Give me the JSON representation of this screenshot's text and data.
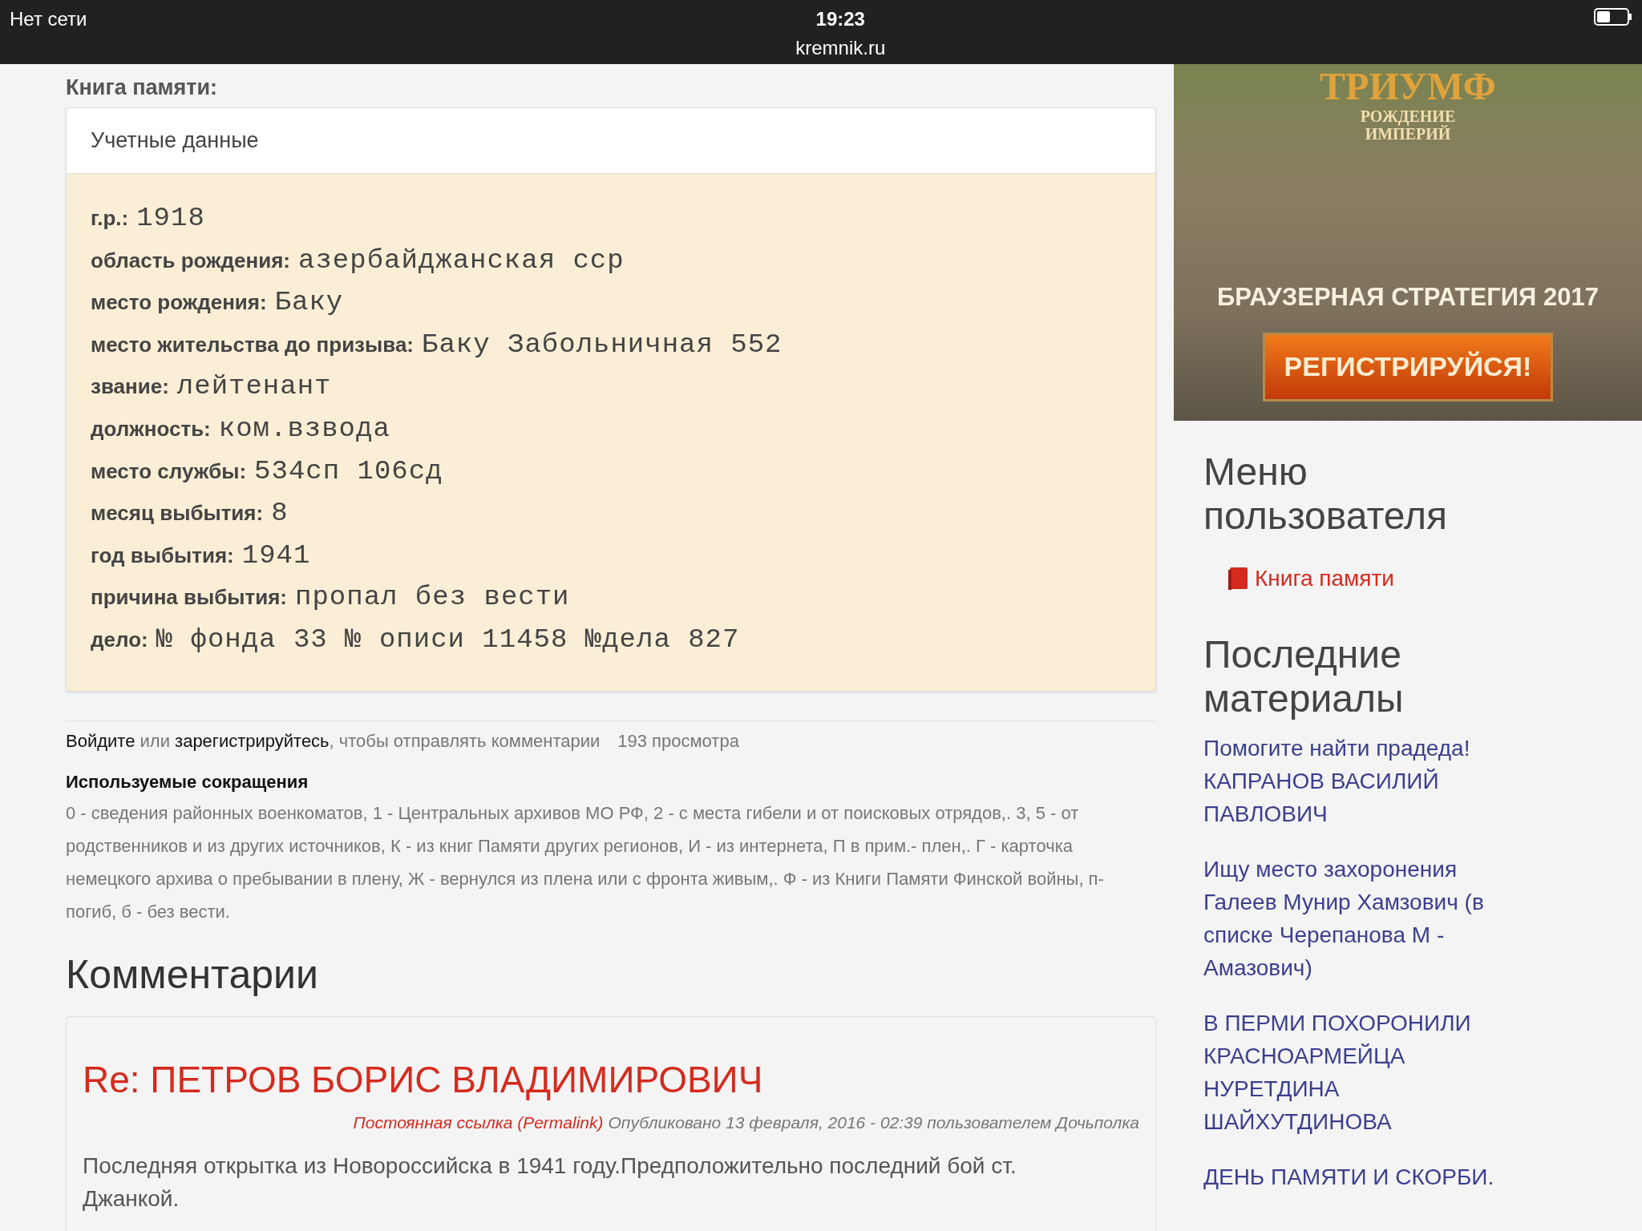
{
  "status_bar": {
    "carrier": "Нет сети",
    "time": "19:23",
    "url": "kremnik.ru"
  },
  "section_label": "Книга памяти:",
  "record_card": {
    "header": "Учетные данные",
    "fields": [
      {
        "label": "г.р.:",
        "value": "1918"
      },
      {
        "label": "область рождения:",
        "value": "азербайджанская сср"
      },
      {
        "label": "место рождения:",
        "value": "Баку"
      },
      {
        "label": "место жительства до призыва:",
        "value": "Баку Забольничная 552"
      },
      {
        "label": "звание:",
        "value": "лейтенант"
      },
      {
        "label": "должность:",
        "value": "ком.взвода"
      },
      {
        "label": "место службы:",
        "value": "534сп 106сд"
      },
      {
        "label": "месяц выбытия:",
        "value": "8"
      },
      {
        "label": "год выбытия:",
        "value": "1941"
      },
      {
        "label": "причина выбытия:",
        "value": "пропал без вести"
      },
      {
        "label": "дело:",
        "value": "№ фонда 33 № описи 11458 №дела 827"
      }
    ]
  },
  "comment_prompt": {
    "login_link": "Войдите",
    "or": "или",
    "register_link": "зарегистрируйтесь",
    "rest": ", чтобы отправлять комментарии",
    "views": "193 просмотра"
  },
  "abbreviations": {
    "title": "Используемые сокращения",
    "text": "0 - сведения районных военкоматов, 1 - Центральных архивов МО РФ, 2 - с места гибели и от поисковых отрядов,. 3, 5 - от родственников и из других источников, К - из книг Памяти других регионов, И - из интернета, П в прим.- плен,. Г - карточка немецкого архива о пребывании в плену, Ж - вернулся из плена или с фронта живым,. Ф - из Книги Памяти Финской войны, п- погиб, б - без вести."
  },
  "comments": {
    "heading": "Комментарии",
    "items": [
      {
        "title": "Re: ПЕТРОВ БОРИС ВЛАДИМИРОВИЧ",
        "permalink": "Постоянная ссылка (Permalink)",
        "meta": "Опубликовано 13 февраля, 2016 - 02:39 пользователем Дочьполка",
        "body": "Последняя открытка из Новороссийска в 1941 году.Предположительно последний бой ст. Джанкой."
      }
    ]
  },
  "ad_banner": {
    "title": "ТРИУМФ",
    "subtitle": "РОЖДЕНИЕ ИМПЕРИЙ",
    "tagline": "БРАУЗЕРНАЯ СТРАТЕГИЯ 2017",
    "button": "РЕГИСТРИРУЙСЯ!"
  },
  "user_menu": {
    "heading": "Меню пользователя",
    "items": [
      "Книга памяти"
    ]
  },
  "recent": {
    "heading": "Последние материалы",
    "items": [
      "Помогите найти прадеда! КАПРАНОВ ВАСИЛИЙ ПАВЛОВИЧ",
      "Ищу место захоронения Галеев Мунир Хамзович (в списке Черепанова М - Амазович)",
      "В ПЕРМИ ПОХОРОНИЛИ КРАСНОАРМЕЙЦА НУРЕТДИНА ШАЙХУТДИНОВА",
      "ДЕНЬ ПАМЯТИ И СКОРБИ."
    ]
  }
}
